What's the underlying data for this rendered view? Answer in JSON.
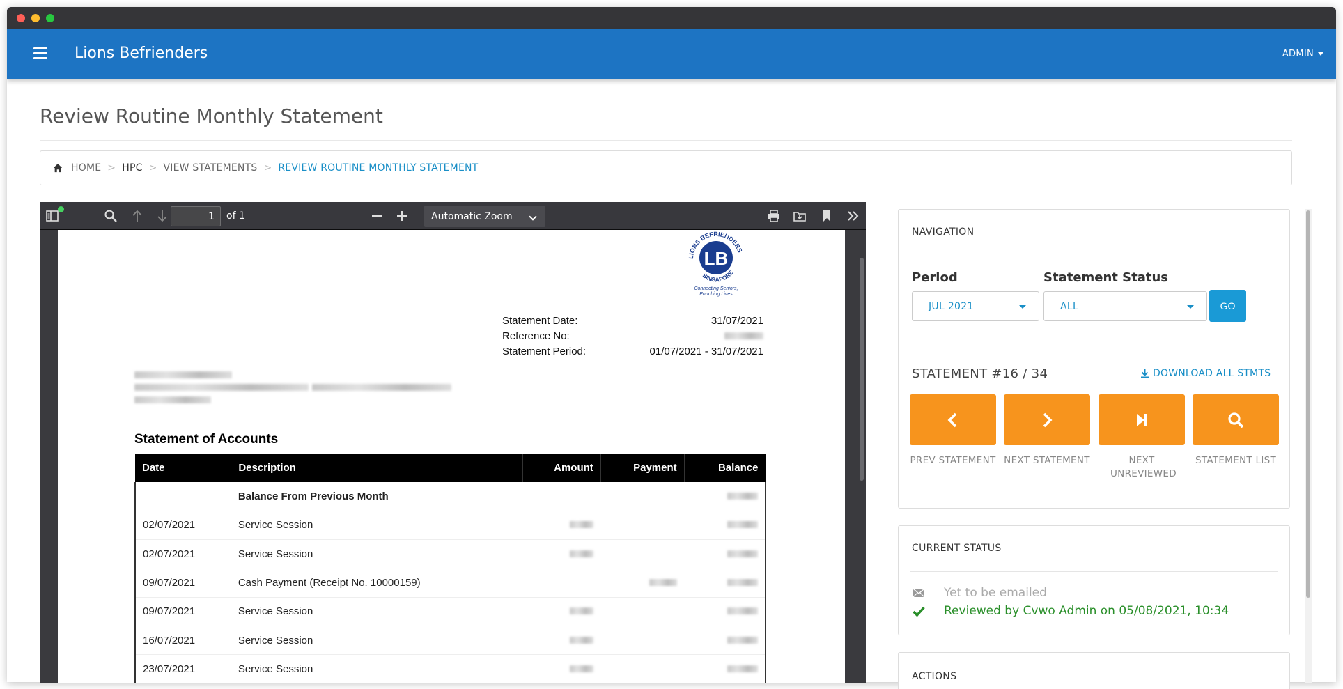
{
  "app": {
    "brand": "Lions Befrienders",
    "user_menu": "ADMIN"
  },
  "page": {
    "title": "Review Routine Monthly Statement"
  },
  "breadcrumb": {
    "items": [
      "HOME",
      "HPC",
      "VIEW STATEMENTS",
      "REVIEW ROUTINE MONTHLY STATEMENT"
    ],
    "separator": ">"
  },
  "pdf_toolbar": {
    "page_number": "1",
    "page_of": "of 1",
    "zoom": "Automatic Zoom"
  },
  "statement": {
    "logo_text_top": "LIONS BEFRIENDERS",
    "logo_text_bottom": "SINGAPORE",
    "logo_mono": "LB",
    "logo_tagline_1": "Connecting Seniors,",
    "logo_tagline_2": "Enriching Lives",
    "meta": [
      {
        "label": "Statement Date:",
        "value": "31/07/2021"
      },
      {
        "label": "Reference No:",
        "value": ""
      },
      {
        "label": "Statement Period:",
        "value": "01/07/2021 - 31/07/2021"
      }
    ],
    "section_title": "Statement of Accounts",
    "columns": [
      "Date",
      "Description",
      "Amount",
      "Payment",
      "Balance"
    ],
    "rows": [
      {
        "date": "",
        "description": "Balance From Previous Month",
        "bold": true,
        "amount": false,
        "payment": false,
        "balance": true
      },
      {
        "date": "02/07/2021",
        "description": "Service Session",
        "bold": false,
        "amount": true,
        "payment": false,
        "balance": true
      },
      {
        "date": "02/07/2021",
        "description": "Service Session",
        "bold": false,
        "amount": true,
        "payment": false,
        "balance": true
      },
      {
        "date": "09/07/2021",
        "description": "Cash Payment (Receipt No. 10000159)",
        "bold": false,
        "amount": false,
        "payment": true,
        "balance": true
      },
      {
        "date": "09/07/2021",
        "description": "Service Session",
        "bold": false,
        "amount": true,
        "payment": false,
        "balance": true
      },
      {
        "date": "16/07/2021",
        "description": "Service Session",
        "bold": false,
        "amount": true,
        "payment": false,
        "balance": true
      },
      {
        "date": "23/07/2021",
        "description": "Service Session",
        "bold": false,
        "amount": true,
        "payment": false,
        "balance": true
      }
    ]
  },
  "navigation": {
    "header": "NAVIGATION",
    "period_label": "Period",
    "period_value": "JUL 2021",
    "status_label": "Statement Status",
    "status_value": "ALL",
    "go_label": "GO",
    "counter": "STATEMENT #16 / 34",
    "download_label": "DOWNLOAD ALL STMTS",
    "buttons": [
      {
        "caption": "PREV STATEMENT"
      },
      {
        "caption": "NEXT STATEMENT"
      },
      {
        "caption": "NEXT UNREVIEWED"
      },
      {
        "caption": "STATEMENT LIST"
      }
    ]
  },
  "current_status": {
    "header": "CURRENT STATUS",
    "email_status": "Yet to be emailed",
    "review_status": "Reviewed by Cvwo Admin on 05/08/2021, 10:34"
  },
  "actions": {
    "header": "ACTIONS"
  },
  "colors": {
    "navbar": "#1d74c3",
    "accent": "#1a8fc7",
    "orange": "#f7941d",
    "success": "#2a8f2a"
  }
}
